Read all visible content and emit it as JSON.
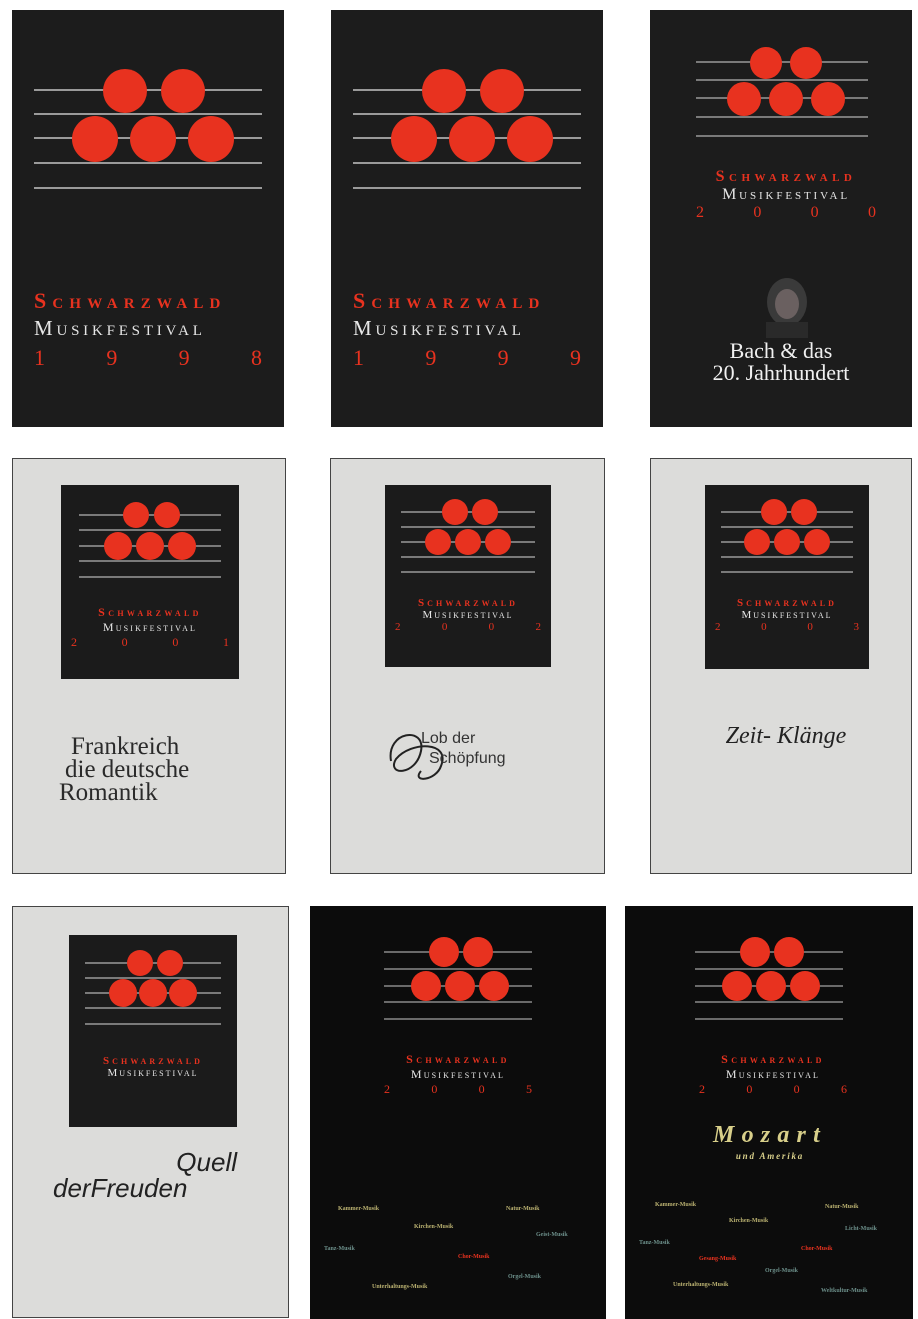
{
  "colors": {
    "accent": "#e8321f",
    "dark": "#1c1c1c",
    "light": "#dcdcda"
  },
  "posters": [
    {
      "brand": "Schwarzwald",
      "festival": "Musikfestival",
      "year": [
        "1",
        "9",
        "9",
        "8"
      ]
    },
    {
      "brand": "Schwarzwald",
      "festival": "Musikfestival",
      "year": [
        "1",
        "9",
        "9",
        "9"
      ]
    },
    {
      "brand": "Schwarzwald",
      "festival": "Musikfestival",
      "year": [
        "2",
        "0",
        "0",
        "0"
      ],
      "subtitle_line1": "Bach & das",
      "subtitle_line2": "20. Jahrhundert"
    },
    {
      "brand": "Schwarzwald",
      "festival": "Musikfestival",
      "year": [
        "2",
        "0",
        "0",
        "1"
      ],
      "subtitle_line1": "Frankreich",
      "subtitle_line2": "die deutsche",
      "subtitle_line3": "Romantik"
    },
    {
      "brand": "Schwarzwald",
      "festival": "Musikfestival",
      "year": [
        "2",
        "0",
        "0",
        "2"
      ],
      "subtitle_line1": "Lob der",
      "subtitle_line2": "Schöpfung"
    },
    {
      "brand": "Schwarzwald",
      "festival": "Musikfestival",
      "year": [
        "2",
        "0",
        "0",
        "3"
      ],
      "subtitle_line1": "Zeit-",
      "subtitle_line2": "Klänge"
    },
    {
      "brand": "Schwarzwald",
      "festival": "Musikfestival",
      "subtitle_line1": "Quell",
      "subtitle_line2": "der",
      "subtitle_line3": "Freuden"
    },
    {
      "brand": "Schwarzwald",
      "festival": "Musikfestival",
      "year": [
        "2",
        "0",
        "0",
        "5"
      ],
      "categories": [
        "Kammer-Musik",
        "Natur-Musik",
        "Kirchen-Musik",
        "Geist-Musik",
        "Tanz-Musik",
        "Chor-Musik",
        "Orgel-Musik",
        "Unterhaltungs-Musik"
      ]
    },
    {
      "brand": "Schwarzwald",
      "festival": "Musikfestival",
      "year": [
        "2",
        "0",
        "0",
        "6"
      ],
      "subtitle_line1": "Mozart",
      "subtitle_line2": "und Amerika",
      "categories": [
        "Kammer-Musik",
        "Natur-Musik",
        "Kirchen-Musik",
        "Licht-Musik",
        "Tanz-Musik",
        "Chor-Musik",
        "Gesang-Musik",
        "Orgel-Musik",
        "Unterhaltungs-Musik",
        "Weltkultur-Musik"
      ]
    }
  ]
}
